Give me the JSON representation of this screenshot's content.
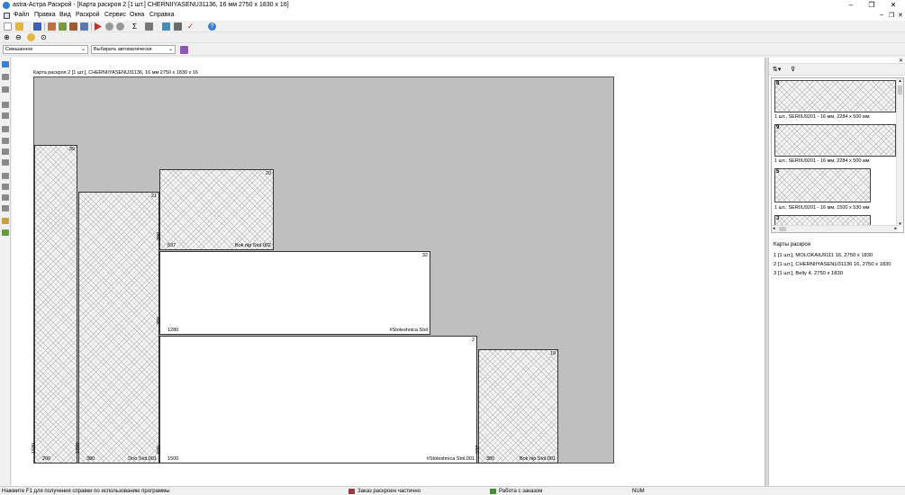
{
  "window": {
    "title": "astra-Астра Раскрой - [Карта раскроя 2 [1 шт.] CHERNIIYASENU31136, 16 мм 2750 x 1830 x 16]",
    "min": "–",
    "max": "❐",
    "close": "✕"
  },
  "menu": [
    "Файл",
    "Правка",
    "Вид",
    "Раскрой",
    "Сервис",
    "Окна",
    "Справка"
  ],
  "toolbar3": {
    "material_combo": "Смешанное",
    "mode_combo": "Выбирать автоматически"
  },
  "sheet": {
    "label": "Карта раскроя 2 [1 шт.], CHERNIIYASENU31136, 16 мм 2750 x 1830 x 16",
    "width_mm": 2750,
    "height_mm": 1830,
    "parts": [
      {
        "num": "39",
        "w": "200",
        "h": "1580",
        "name": "",
        "hatched": true
      },
      {
        "num": "21",
        "w": "380",
        "h": "1280",
        "name": "Dno Stol.001",
        "hatched": true
      },
      {
        "num": "20",
        "w": "537",
        "h": "380",
        "name": "Bok nip Stol.002",
        "hatched": true
      },
      {
        "num": "32",
        "w": "1280",
        "h": "396",
        "name": "#Stoleshnica Stol",
        "hatched": false
      },
      {
        "num": "2",
        "w": "1500",
        "h": "600",
        "name": "#Stoleshnica Stol.001",
        "hatched": false
      },
      {
        "num": "19",
        "w": "380",
        "h": "537",
        "name": "Bok nip Stol.001",
        "hatched": true
      }
    ]
  },
  "parts_panel": {
    "items": [
      {
        "num": "8",
        "caption": "1 шт., SERIIU9201 - 16 мм, 2284 x 500 мм"
      },
      {
        "num": "9",
        "caption": "1 шт., SERIIU9201 - 16 мм, 2284 x 500 мм"
      },
      {
        "num": "5",
        "caption": "1 шт., SERIIU9201 - 16 мм, 1500 x 530 мм"
      },
      {
        "num": "3",
        "caption": ""
      }
    ]
  },
  "sheets_panel": {
    "title": "Карты раскроя",
    "items": [
      "1 [1 шт.], MOLOKAIU9111 16, 2750 x 1830",
      "2 [1 шт.], CHERNIIYASENU31136 16, 2750 x 1830",
      "3 [1 шт.], Beliy 4, 2750 x 1830"
    ]
  },
  "status": {
    "help": "Нажмите F1 для получения справки по использованию программы",
    "order": "Заказ раскроен частично",
    "work": "Работа с заказом",
    "num": "NUM"
  },
  "colors": {
    "sheet_bg": "#bfbfbf",
    "accent": "#2a7fd4"
  }
}
